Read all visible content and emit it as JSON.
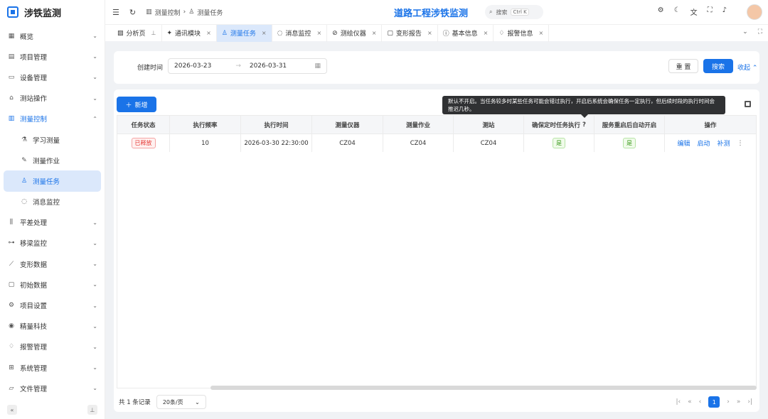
{
  "app": {
    "logo_text": "涉铁监测",
    "brand": "道路工程涉铁监测"
  },
  "sidebar": {
    "items": [
      {
        "label": "概览",
        "icon": "grid-icon"
      },
      {
        "label": "项目管理",
        "icon": "clipboard-icon"
      },
      {
        "label": "设备管理",
        "icon": "monitor-icon"
      },
      {
        "label": "测站操作",
        "icon": "bank-icon"
      },
      {
        "label": "测量控制",
        "icon": "chart-box-icon"
      },
      {
        "label": "学习测量",
        "icon": "flask-icon"
      },
      {
        "label": "测量作业",
        "icon": "wrench-icon"
      },
      {
        "label": "测量任务",
        "icon": "user-icon"
      },
      {
        "label": "消息监控",
        "icon": "chat-icon"
      },
      {
        "label": "平差处理",
        "icon": "columns-icon"
      },
      {
        "label": "移梁监控",
        "icon": "nodes-icon"
      },
      {
        "label": "变形数据",
        "icon": "trend-icon"
      },
      {
        "label": "初始数据",
        "icon": "doc-icon"
      },
      {
        "label": "项目设置",
        "icon": "gear-icon"
      },
      {
        "label": "精量科技",
        "icon": "radio-icon"
      },
      {
        "label": "报警管理",
        "icon": "alarm-icon"
      },
      {
        "label": "系统管理",
        "icon": "apps-icon"
      },
      {
        "label": "文件管理",
        "icon": "folder-icon"
      }
    ]
  },
  "header": {
    "breadcrumb": [
      "测量控制",
      "测量任务"
    ],
    "search_placeholder": "搜索",
    "search_shortcut": "Ctrl K"
  },
  "tabs": [
    {
      "label": "分析页"
    },
    {
      "label": "通讯模块"
    },
    {
      "label": "测量任务"
    },
    {
      "label": "消息监控"
    },
    {
      "label": "测绘仪器"
    },
    {
      "label": "变形报告"
    },
    {
      "label": "基本信息"
    },
    {
      "label": "报警信息"
    }
  ],
  "filter": {
    "label": "创建时间",
    "start_date": "2026-03-23",
    "end_date": "2026-03-31",
    "reset_label": "重 置",
    "search_label": "搜索",
    "collapse_label": "收起"
  },
  "toolbar": {
    "add_label": "新增"
  },
  "tooltip": "默认不开启。当任务较多时某些任务可能会错过执行，开启后系统会确保任务一定执行，但后续时段的执行时间会推迟几秒。",
  "table": {
    "headers": [
      "任务状态",
      "执行频率",
      "执行时间",
      "测量仪器",
      "测量作业",
      "测站",
      "确保定时任务执行",
      "服务重启后自动开启",
      "操作"
    ],
    "rows": [
      {
        "status": "已释放",
        "frequency": "10",
        "exec_time": "2026-03-30 22:30:00",
        "instrument": "CZ04",
        "job": "CZ04",
        "station": "CZ04",
        "ensure": "是",
        "auto_start": "是",
        "actions": [
          "编辑",
          "启动",
          "补测"
        ]
      }
    ]
  },
  "pagination": {
    "total_text": "共 1 条记录",
    "page_size": "20条/页",
    "current_page": "1"
  },
  "colors": {
    "accent": "#1a73e8",
    "danger": "#e53935",
    "success": "#3a9a1c"
  }
}
